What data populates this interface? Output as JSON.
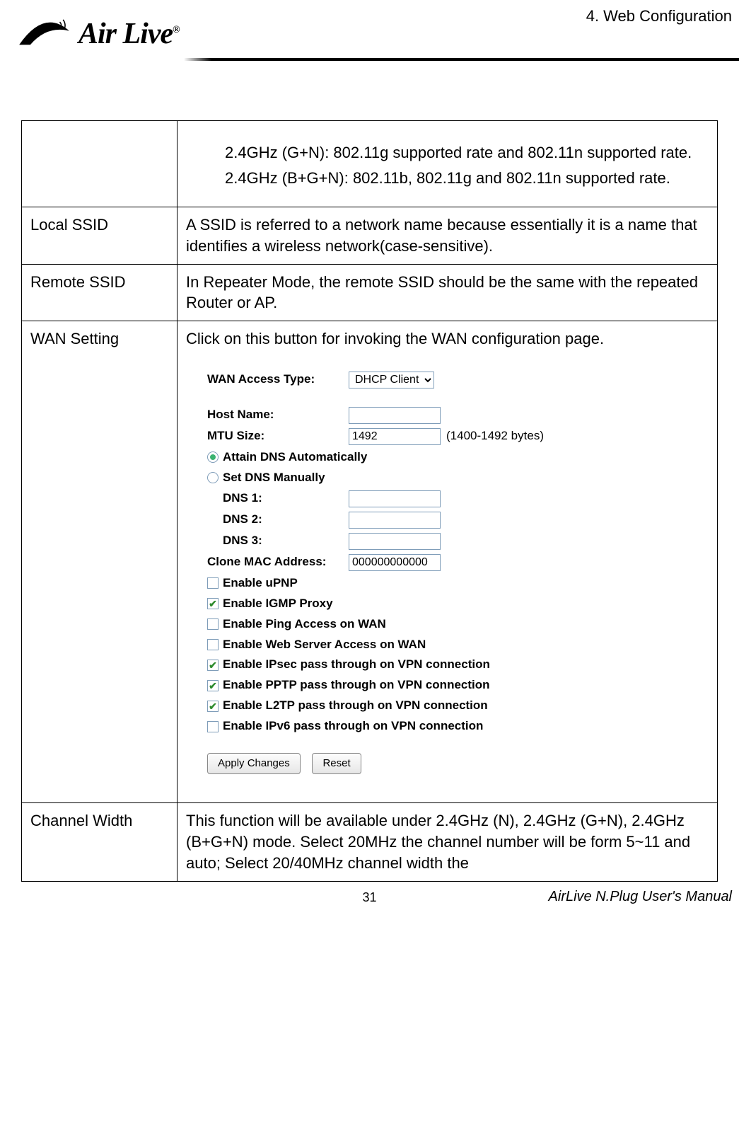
{
  "header": {
    "chapter": "4.  Web  Configuration",
    "logo_text": "Air Live",
    "reg": "®"
  },
  "table": {
    "row1_rates": {
      "line1": "2.4GHz (G+N): 802.11g supported rate and 802.11n supported rate.",
      "line2": "2.4GHz (B+G+N): 802.11b, 802.11g and 802.11n supported rate."
    },
    "local_ssid": {
      "label": "Local SSID",
      "desc": "A SSID is referred to a network name because essentially it is a name that identifies a wireless network(case-sensitive)."
    },
    "remote_ssid": {
      "label": "Remote SSID",
      "desc": "In Repeater Mode, the remote SSID should be the same with the repeated Router or AP."
    },
    "wan": {
      "label": "WAN Setting",
      "intro": "Click on this button for invoking the WAN configuration page.",
      "ui": {
        "wan_access_type_label": "WAN Access Type:",
        "wan_access_type_value": "DHCP Client",
        "host_name_label": "Host Name:",
        "host_name_value": "",
        "mtu_label": "MTU Size:",
        "mtu_value": "1492",
        "mtu_hint": "(1400-1492 bytes)",
        "dns_auto": "Attain DNS Automatically",
        "dns_manual": "Set DNS Manually",
        "dns1_label": "DNS 1:",
        "dns2_label": "DNS 2:",
        "dns3_label": "DNS 3:",
        "dns1_value": "",
        "dns2_value": "",
        "dns3_value": "",
        "clone_mac_label": "Clone MAC Address:",
        "clone_mac_value": "000000000000",
        "cb_upnp": "Enable uPNP",
        "cb_igmp": "Enable IGMP Proxy",
        "cb_ping": "Enable Ping Access on WAN",
        "cb_web": "Enable Web Server Access on WAN",
        "cb_ipsec": "Enable IPsec pass through on VPN connection",
        "cb_pptp": "Enable PPTP pass through on VPN connection",
        "cb_l2tp": "Enable L2TP pass through on VPN connection",
        "cb_ipv6": "Enable IPv6 pass through on VPN connection",
        "btn_apply": "Apply Changes",
        "btn_reset": "Reset"
      }
    },
    "channel_width": {
      "label": "Channel Width",
      "desc": "This function will be available under 2.4GHz (N), 2.4GHz (G+N), 2.4GHz (B+G+N) mode. Select 20MHz the channel number will be form 5~11 and auto; Select 20/40MHz channel width the"
    }
  },
  "footer": {
    "page_number": "31",
    "manual": "AirLive N.Plug User's Manual"
  }
}
